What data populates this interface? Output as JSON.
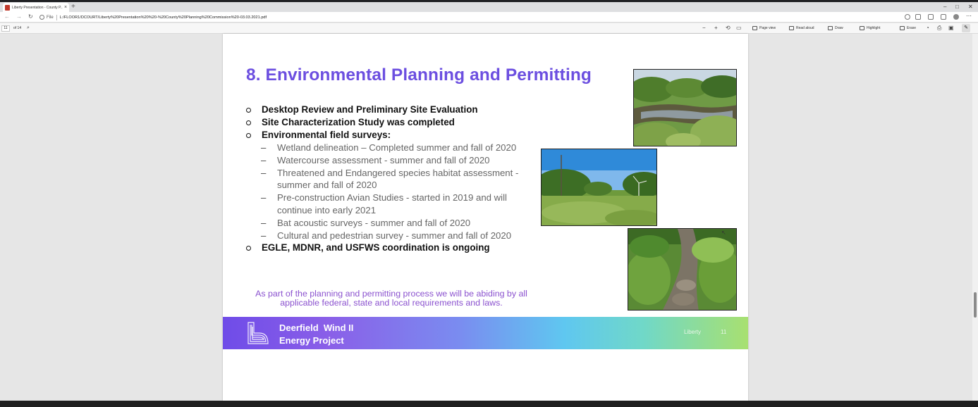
{
  "browser": {
    "tab_title": "Liberty Presentation - County P...",
    "tab_close": "×",
    "new_tab": "+",
    "window_controls": [
      "–",
      "□",
      "✕"
    ],
    "file_label": "File",
    "url": "L:/FLOOR1/DCOURT/Liberty%20Presentation%20%20-%20County%20Planning%20Commission%20-03.03.2021.pdf",
    "more_menu": "⋯"
  },
  "pdf_toolbar": {
    "page_number": "11",
    "page_of": "of 14",
    "zoom_out": "−",
    "zoom_in": "+",
    "page_view": "Page view",
    "read_aloud": "Read aloud",
    "draw": "Draw",
    "highlight": "Highlight",
    "erase": "Erase",
    "pin": "✎"
  },
  "slide": {
    "title": "8. Environmental Planning and Permitting",
    "bullets": [
      "Desktop Review and Preliminary Site Evaluation",
      "Site Characterization Study was completed",
      "Environmental field surveys:"
    ],
    "sub_bullets": [
      "Wetland delineation – Completed summer and fall of 2020",
      "Watercourse assessment - summer and fall of 2020",
      "Threatened and Endangered species habitat assessment - summer and fall of 2020",
      "Pre-construction Avian Studies - started in 2019 and will continue into early 2021",
      "Bat acoustic surveys - summer and fall of 2020",
      "Cultural and pedestrian survey - summer and fall of 2020"
    ],
    "last_bullet": "EGLE, MDNR, and USFWS coordination is ongoing",
    "note": "As part of the planning and permitting process  we will be abiding by all applicable federal, state and local requirements and laws.",
    "banner_title": "Deerfield  Wind II\nEnergy Project",
    "banner_brand": "Liberty",
    "page_number": "11"
  },
  "colors": {
    "title": "#6c4fe0",
    "note": "#8b52cf"
  }
}
